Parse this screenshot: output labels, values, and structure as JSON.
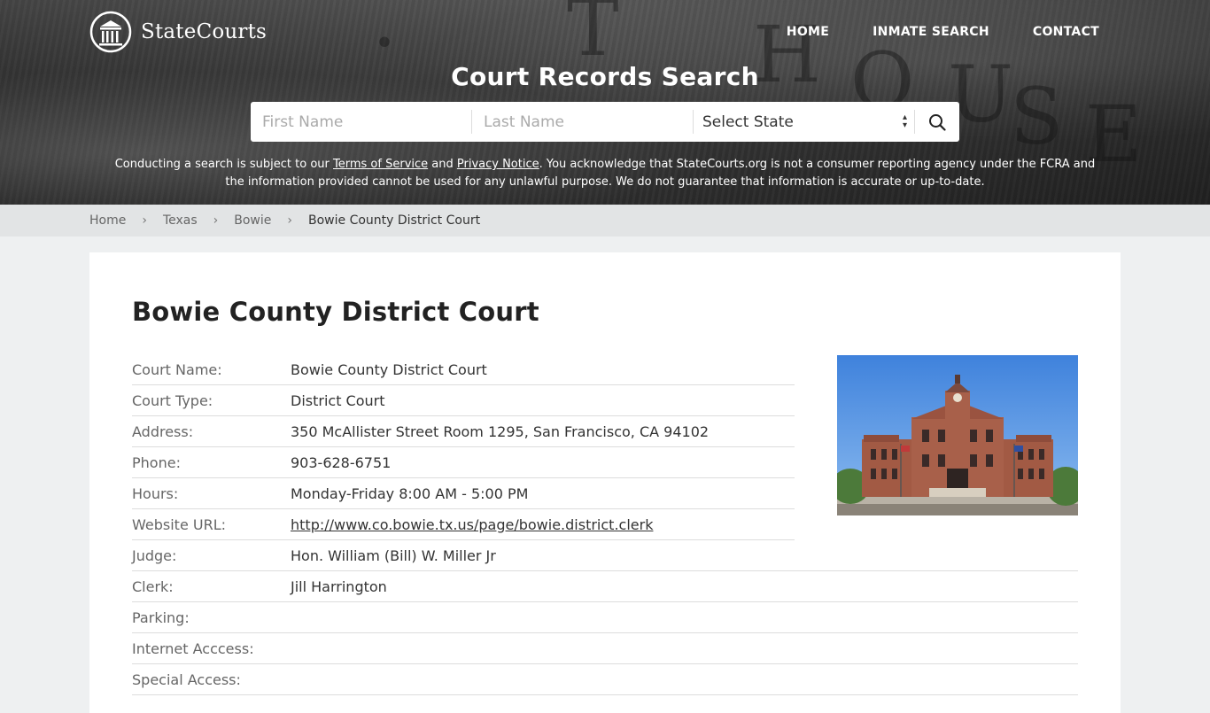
{
  "brand": {
    "name": "StateCourts"
  },
  "nav": [
    "HOME",
    "INMATE SEARCH",
    "CONTACT"
  ],
  "hero": {
    "title": "Court Records Search",
    "first_name_placeholder": "First Name",
    "last_name_placeholder": "Last Name",
    "state_select": "Select State",
    "disclaimer_prefix": "Conducting a search is subject to our ",
    "terms_link": "Terms of Service",
    "and": " and ",
    "privacy_link": "Privacy Notice",
    "disclaimer_suffix": ". You acknowledge that StateCourts.org is not a consumer reporting agency under the FCRA and the information provided cannot be used for any unlawful purpose. We do not guarantee that information is accurate or up-to-date."
  },
  "breadcrumb": [
    "Home",
    "Texas",
    "Bowie",
    "Bowie County District Court"
  ],
  "page": {
    "title": "Bowie County District Court",
    "rows": [
      {
        "label": "Court Name:",
        "value": "Bowie County District Court"
      },
      {
        "label": "Court Type:",
        "value": "District Court"
      },
      {
        "label": "Address:",
        "value": "350 McAllister Street Room 1295, San Francisco, CA 94102"
      },
      {
        "label": "Phone:",
        "value": "903-628-6751"
      },
      {
        "label": "Hours:",
        "value": "Monday-Friday 8:00 AM - 5:00 PM"
      },
      {
        "label": "Website URL:",
        "value": "http://www.co.bowie.tx.us/page/bowie.district.clerk"
      },
      {
        "label": "Judge:",
        "value": "Hon. William (Bill) W. Miller Jr"
      },
      {
        "label": "Clerk:",
        "value": "Jill Harrington"
      },
      {
        "label": "Parking:",
        "value": ""
      },
      {
        "label": "Internet Acccess:",
        "value": ""
      },
      {
        "label": "Special Access:",
        "value": ""
      }
    ]
  },
  "colors": {
    "sky": "#4f8fe0",
    "brick": "#a25a44",
    "text": "#333333"
  }
}
